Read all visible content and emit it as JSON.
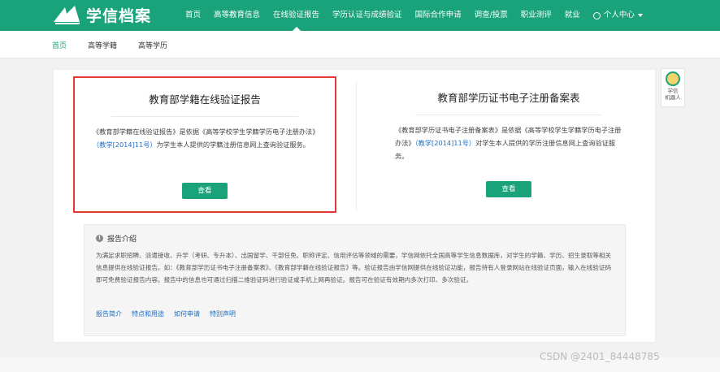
{
  "header": {
    "logo_text": "学信档案",
    "nav": [
      {
        "label": "首页"
      },
      {
        "label": "高等教育信息"
      },
      {
        "label": "在线验证报告"
      },
      {
        "label": "学历认证与成绩验证"
      },
      {
        "label": "国际合作申请"
      },
      {
        "label": "调查/投票"
      },
      {
        "label": "职业测评"
      },
      {
        "label": "就业"
      }
    ],
    "user_label": "个人中心"
  },
  "subnav": [
    {
      "label": "首页"
    },
    {
      "label": "高等学籍"
    },
    {
      "label": "高等学历"
    }
  ],
  "cards": [
    {
      "title": "教育部学籍在线验证报告",
      "desc_before": "《教育部学籍在线验证报告》是依据《高等学校学生学籍学历电子注册办法》",
      "desc_link": "（教学[2014]11号）",
      "desc_after": "为学生本人提供的学籍注册信息网上查询验证服务。",
      "button": "查看"
    },
    {
      "title": "教育部学历证书电子注册备案表",
      "desc_before": "《教育部学历证书电子注册备案表》是依据《高等学校学生学籍学历电子注册办法》",
      "desc_link": "（教学[2014]11号）",
      "desc_after": "对学生本人提供的学历注册信息网上查询验证服务。",
      "button": "查看"
    }
  ],
  "intro": {
    "title": "报告介绍",
    "body": "为满足求职招聘、派遣接收、升学（考研、专升本）、出国留学、干部任免、职称评定、信用评估等领域的需要，学信网依托全国高等学生信息数据库，对学生的学籍、学历、招生录取等相关信息提供在线验证报告。如：《教育部学历证书电子注册备案表》、《教育部学籍在线验证报告》等。验证报告由学信网提供在线验证功能，报告持有人登录网站在线验证页面，输入在线验证码即可免费验证报告内容。报告中的信息也可通过扫描二维验证码进行验证或手机上网再验证。报告可在验证有效期内多次打印、多次验证。",
    "links": [
      {
        "label": "报告简介"
      },
      {
        "label": "特点和用途"
      },
      {
        "label": "如何申请"
      },
      {
        "label": "特别声明"
      }
    ]
  },
  "robot": {
    "label_line1": "学信",
    "label_line2": "机器人"
  },
  "watermark": "CSDN @2401_84448785",
  "colors": {
    "brand": "#1aa37a",
    "highlight": "#e53935",
    "link": "#1e6fc4"
  }
}
